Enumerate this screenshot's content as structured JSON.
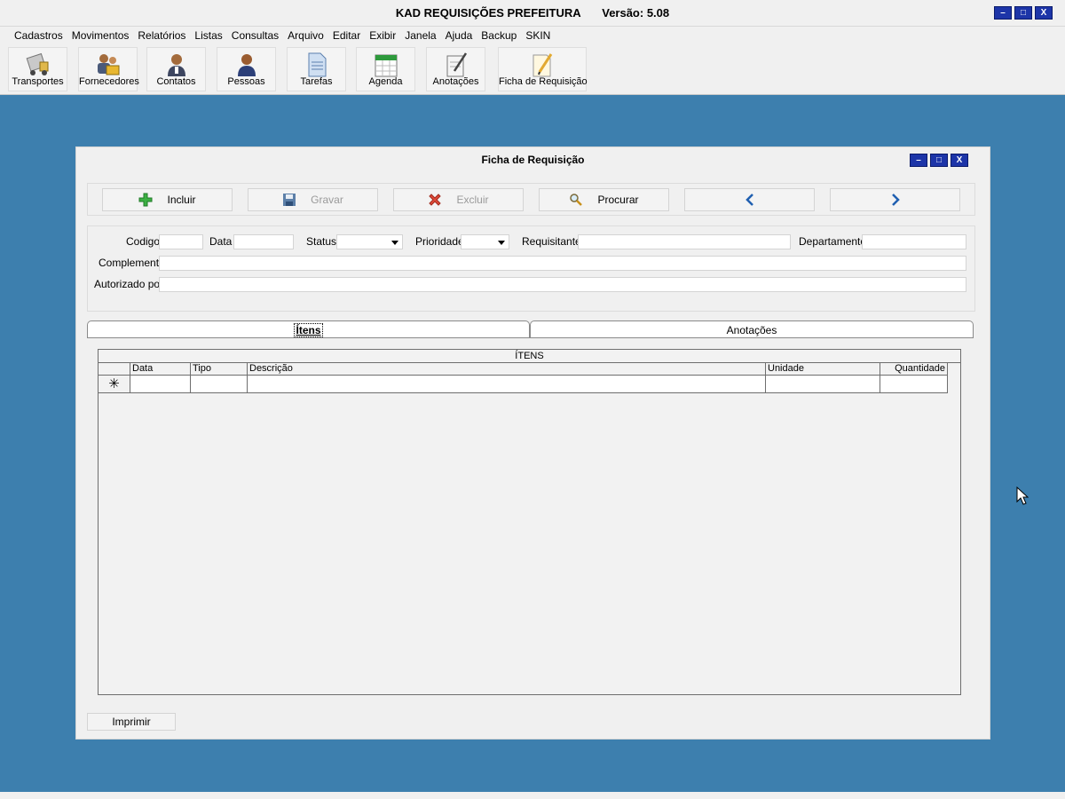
{
  "app": {
    "title": "KAD REQUISIÇÕES PREFEITURA",
    "version": "Versão: 5.08"
  },
  "window_controls": {
    "minimize": "–",
    "maximize": "□",
    "close": "X"
  },
  "menu": [
    "Cadastros",
    "Movimentos",
    "Relatórios",
    "Listas",
    "Consultas",
    "Arquivo",
    "Editar",
    "Exibir",
    "Janela",
    "Ajuda",
    "Backup",
    "SKIN"
  ],
  "toolbar": [
    {
      "label": "Transportes",
      "icon": "truck-icon"
    },
    {
      "label": "Fornecedores",
      "icon": "suppliers-icon"
    },
    {
      "label": "Contatos",
      "icon": "contact-icon"
    },
    {
      "label": "Pessoas",
      "icon": "person-icon"
    },
    {
      "label": "Tarefas",
      "icon": "document-icon"
    },
    {
      "label": "Agenda",
      "icon": "calendar-icon"
    },
    {
      "label": "Anotações",
      "icon": "notepad-icon"
    },
    {
      "label": "Ficha de Requisição",
      "icon": "pencil-paper-icon"
    }
  ],
  "child_window": {
    "title": "Ficha de Requisição"
  },
  "actions": {
    "incluir": "Incluir",
    "gravar": "Gravar",
    "excluir": "Excluir",
    "procurar": "Procurar"
  },
  "form": {
    "codigo": "Codigo",
    "data": "Data",
    "status": "Status",
    "prioridade": "Prioridade",
    "requisitante": "Requisitante",
    "departamento": "Departamento",
    "complemento": "Complemento",
    "autorizado_por": "Autorizado por"
  },
  "tabs": {
    "itens": "Ítens",
    "anotacoes": "Anotações"
  },
  "grid": {
    "caption": "ÍTENS",
    "columns": [
      "Data",
      "Tipo",
      "Descrição",
      "Unidade",
      "Quantidade"
    ],
    "new_row_marker": "✳"
  },
  "print": {
    "label": "Imprimir"
  },
  "colors": {
    "desktop": "#3d7fae",
    "window_button": "#1d35a8",
    "form_bg": "#f0f0f0"
  }
}
